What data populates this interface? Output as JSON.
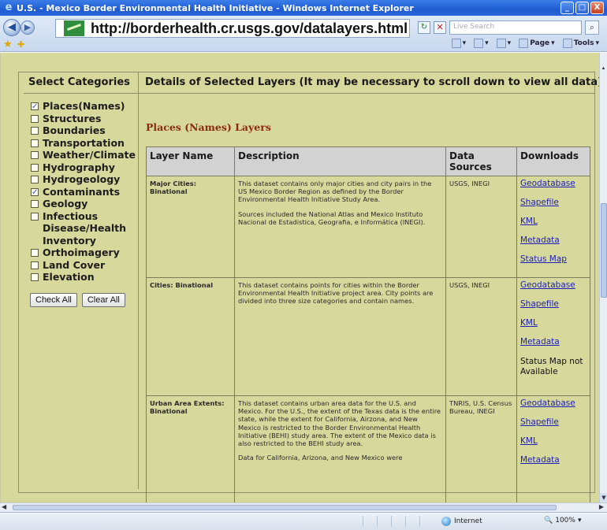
{
  "window": {
    "title": "U.S. - Mexico Border Environmental Health Initiative - Windows Internet Explorer",
    "minimize": "_",
    "maximize": "□",
    "close": "X"
  },
  "addressbar": {
    "url": "http://borderhealth.cr.usgs.gov/datalayers.html",
    "search_placeholder": "Live Search"
  },
  "commandbar": {
    "page": "Page",
    "tools": "Tools"
  },
  "left_panel": {
    "heading": "Select Categories",
    "categories": [
      {
        "label": "Places(Names)",
        "checked": true
      },
      {
        "label": "Structures",
        "checked": false
      },
      {
        "label": "Boundaries",
        "checked": false
      },
      {
        "label": "Transportation",
        "checked": false
      },
      {
        "label": "Weather/Climate",
        "checked": false
      },
      {
        "label": "Hydrography",
        "checked": false
      },
      {
        "label": "Hydrogeology",
        "checked": false
      },
      {
        "label": "Contaminants",
        "checked": true
      },
      {
        "label": "Geology",
        "checked": false
      },
      {
        "label": "Infectious Disease/Health Inventory",
        "checked": false
      },
      {
        "label": "Orthoimagery",
        "checked": false
      },
      {
        "label": "Land Cover",
        "checked": false
      },
      {
        "label": "Elevation",
        "checked": false
      }
    ],
    "check_all": "Check All",
    "clear_all": "Clear All"
  },
  "right_panel": {
    "heading": "Details of Selected Layers (It may be necessary to scroll down to view all data)",
    "section_title": "Places (Names) Layers",
    "columns": [
      "Layer Name",
      "Description",
      "Data Sources",
      "Downloads"
    ],
    "rows": [
      {
        "name": "Major Cities: Binational",
        "description": [
          "This dataset contains only major cities and city pairs in the US Mexico Border Region as defined by the Border Environmental Health Initiative Study Area.",
          "Sources included the National Atlas and Mexico Instituto Nacional de Estadistica, Geografia, e Informática (INEGI)."
        ],
        "sources": "USGS, INEGI",
        "downloads": [
          "Geodatabase",
          "Shapefile",
          "KML",
          "Metadata",
          "Status Map"
        ],
        "status_na": ""
      },
      {
        "name": "Cities: Binational",
        "description": [
          "This dataset contains points for cities within the Border Environmental Health Initiative project area. City points are divided into three size categories and contain names."
        ],
        "sources": "USGS, INEGI",
        "downloads": [
          "Geodatabase",
          "Shapefile",
          "KML",
          "Metadata"
        ],
        "status_na": "Status Map not Available"
      },
      {
        "name": "Urban Area Extents: Binational",
        "description": [
          "This dataset contains urban area data for the U.S. and Mexico. For the U.S., the extent of the Texas data is the entire state, while the extent for California, Airzona, and New Mexico is restricted to the Border Environmental Health Initiative (BEHI) study area. The extent of the Mexico data is also restricted to the BEHI study area.",
          "Data for California, Arizona, and New Mexico were"
        ],
        "sources": "TNRIS, U.S. Census Bureau, INEGI",
        "downloads": [
          "Geodatabase",
          "Shapefile",
          "KML",
          "Metadata"
        ],
        "status_na": ""
      }
    ]
  },
  "statusbar": {
    "zone": "Internet",
    "zoom": "100%"
  }
}
